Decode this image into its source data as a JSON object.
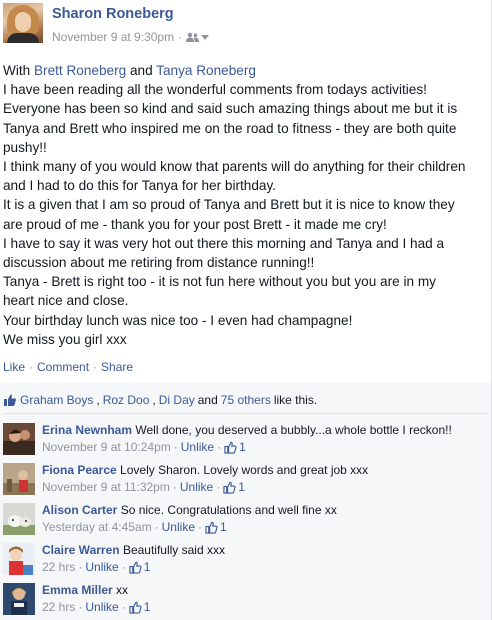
{
  "post": {
    "author": "Sharon Roneberg",
    "timestamp": "November 9 at 9:30pm",
    "separator": "·",
    "audience_icon": "friends-icon",
    "with_prefix": "With",
    "with_person1": "Brett Roneberg",
    "with_and": "and",
    "with_person2": "Tanya Roneberg",
    "lines": [
      "I have been reading all the wonderful comments from todays activities!",
      "Everyone has been so kind and said such amazing things about me but it is",
      "Tanya and Brett who inspired me on the road to fitness - they are both quite",
      "pushy!!",
      "I think many of you would know that parents will do anything for their children",
      "and I had to do this for Tanya for her birthday.",
      "It is a given that I am so proud of Tanya and Brett but it is nice to know they",
      "are proud of me - thank you for your post Brett - it made me cry!",
      "I have to say it was very hot out there this morning and Tanya and I had a",
      "discussion about me retiring from distance running!!",
      "Tanya - Brett is right too - it is not fun here without you but you are in my",
      "heart nice and close.",
      "Your birthday lunch was nice too - I even had champagne!",
      "We miss you girl xxx"
    ]
  },
  "actions": {
    "like": "Like",
    "comment": "Comment",
    "share": "Share",
    "dot": "·"
  },
  "likes": {
    "person1": "Graham Boys",
    "comma1": ",",
    "person2": "Roz Doo",
    "comma2": ",",
    "person3": "Di Day",
    "and": "and",
    "others": "75 others",
    "suffix": "like this."
  },
  "comments": [
    {
      "name": "Erina Newnham",
      "text": "Well done, you deserved a bubbly...a whole bottle I reckon!!",
      "time": "November 9 at 10:24pm",
      "unlike": "Unlike",
      "likes": "1"
    },
    {
      "name": "Fiona Pearce",
      "text": "Lovely Sharon. Lovely words and great job xxx",
      "time": "November 9 at 11:32pm",
      "unlike": "Unlike",
      "likes": "1"
    },
    {
      "name": "Alison Carter",
      "text": "So nice. Congratulations and well fine xx",
      "time": "Yesterday at 4:45am",
      "unlike": "Unlike",
      "likes": "1"
    },
    {
      "name": "Claire Warren",
      "text": "Beautifully said xxx",
      "time": "22 hrs",
      "unlike": "Unlike",
      "likes": "1"
    },
    {
      "name": "Emma Miller",
      "text": "xx",
      "time": "22 hrs",
      "unlike": "Unlike",
      "likes": "1"
    }
  ],
  "colors": {
    "link": "#3b5998",
    "meta": "#90949c",
    "ufi_bg": "#f6f7f9"
  }
}
